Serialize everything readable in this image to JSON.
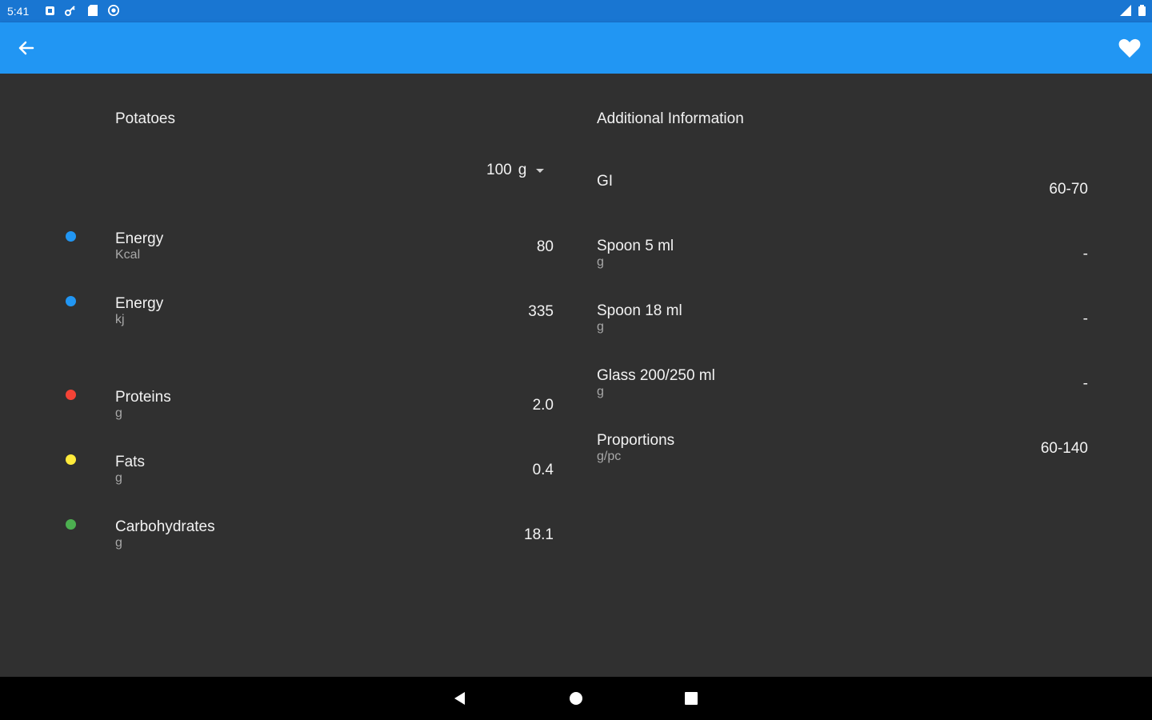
{
  "status_bar": {
    "time": "5:41",
    "icons": [
      "notification-icon",
      "key-icon",
      "sd-card-icon",
      "sync-icon"
    ],
    "right_icons": [
      "signal-icon",
      "battery-icon"
    ]
  },
  "app_bar": {
    "back_icon": "arrow-back-icon",
    "favorite_icon": "heart-icon",
    "color": "#2196f3"
  },
  "nutrition": {
    "title": "Potatoes",
    "amount_value": "100",
    "amount_unit": "g",
    "rows": [
      {
        "label": "Energy",
        "unit": "Kcal",
        "value": "80",
        "color": "#2196f3"
      },
      {
        "label": "Energy",
        "unit": "kj",
        "value": "335",
        "color": "#2196f3"
      },
      {
        "label": "Proteins",
        "unit": "g",
        "value": "2.0",
        "color": "#f44336"
      },
      {
        "label": "Fats",
        "unit": "g",
        "value": "0.4",
        "color": "#ffeb3b"
      },
      {
        "label": "Carbohydrates",
        "unit": "g",
        "value": "18.1",
        "color": "#4caf50"
      }
    ]
  },
  "additional": {
    "title": "Additional Information",
    "rows": [
      {
        "label": "GI",
        "unit": "",
        "value": "60-70"
      },
      {
        "label": "Spoon 5 ml",
        "unit": "g",
        "value": "-"
      },
      {
        "label": "Spoon 18 ml",
        "unit": "g",
        "value": "-"
      },
      {
        "label": "Glass 200/250 ml",
        "unit": "g",
        "value": "-"
      },
      {
        "label": "Proportions",
        "unit": "g/pc",
        "value": "60-140"
      }
    ]
  },
  "nav_bar": {
    "icons": [
      "back-triangle-icon",
      "home-circle-icon",
      "recents-square-icon"
    ]
  }
}
